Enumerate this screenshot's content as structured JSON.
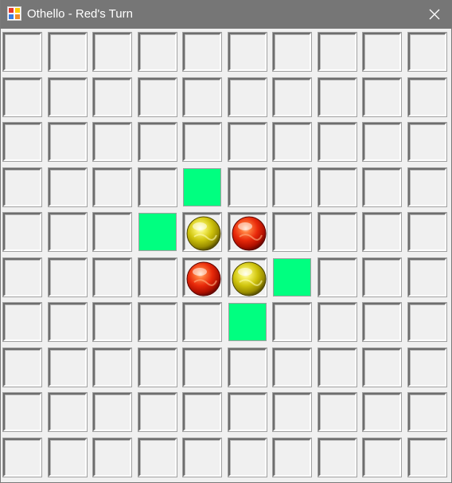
{
  "window": {
    "title": "Othello - Red's Turn",
    "app_icon": "windows-forms-app-icon",
    "close_icon": "close-icon"
  },
  "board": {
    "rows": 10,
    "cols": 10,
    "pieces": [
      {
        "row": 4,
        "col": 4,
        "color": "yellow"
      },
      {
        "row": 4,
        "col": 5,
        "color": "red"
      },
      {
        "row": 5,
        "col": 4,
        "color": "red"
      },
      {
        "row": 5,
        "col": 5,
        "color": "yellow"
      }
    ],
    "valid_moves": [
      {
        "row": 3,
        "col": 4
      },
      {
        "row": 4,
        "col": 3
      },
      {
        "row": 5,
        "col": 6
      },
      {
        "row": 6,
        "col": 5
      }
    ],
    "colors": {
      "valid_move": "#00ff80",
      "cell_face": "#f0f0f0",
      "titlebar": "#767676"
    }
  }
}
